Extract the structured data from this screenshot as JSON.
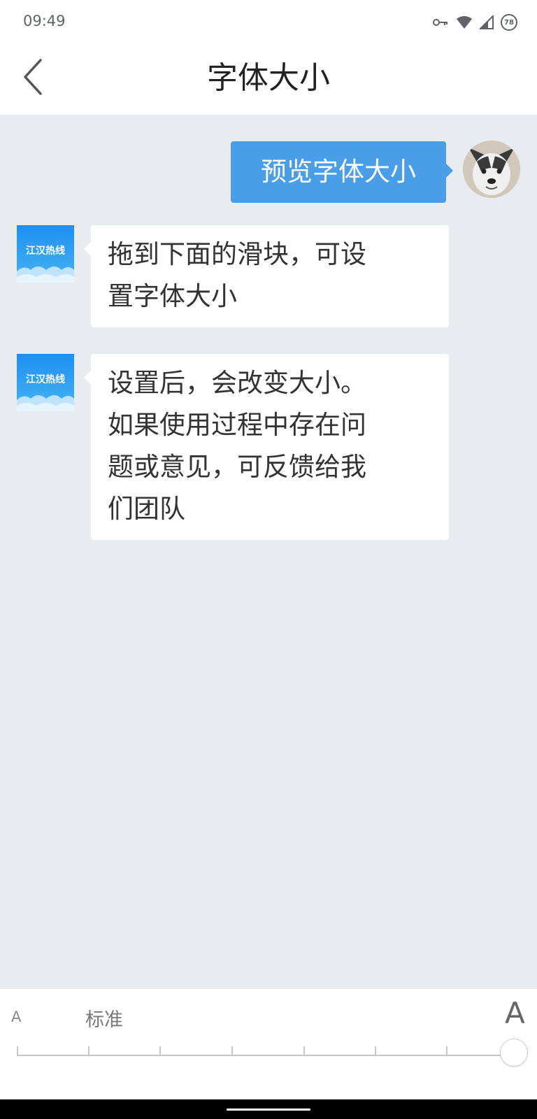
{
  "status_bar": {
    "time": "09:49",
    "battery": "78",
    "icons": [
      "vpn-key-icon",
      "wifi-icon",
      "cell-signal-icon",
      "battery-icon"
    ]
  },
  "header": {
    "title": "字体大小",
    "back_icon": "chevron-left-icon"
  },
  "chat": {
    "user_message": "预览字体大小",
    "bot_name": "江汉热线",
    "bot_messages": [
      {
        "lines": [
          "拖到下面的滑块，可设",
          "置字体大小"
        ]
      },
      {
        "lines": [
          "设置后，会改变大小。",
          "如果使用过程中存在问",
          "题或意见，可反馈给我",
          "们团队"
        ]
      }
    ]
  },
  "font_panel": {
    "small_label": "A",
    "selected_label": "标准",
    "large_label": "A",
    "slider_level": 7,
    "slider_steps": 8
  },
  "colors": {
    "accent": "#4a9ee8",
    "background": "#e8ebef",
    "bot_logo": "#2f9ff0"
  }
}
